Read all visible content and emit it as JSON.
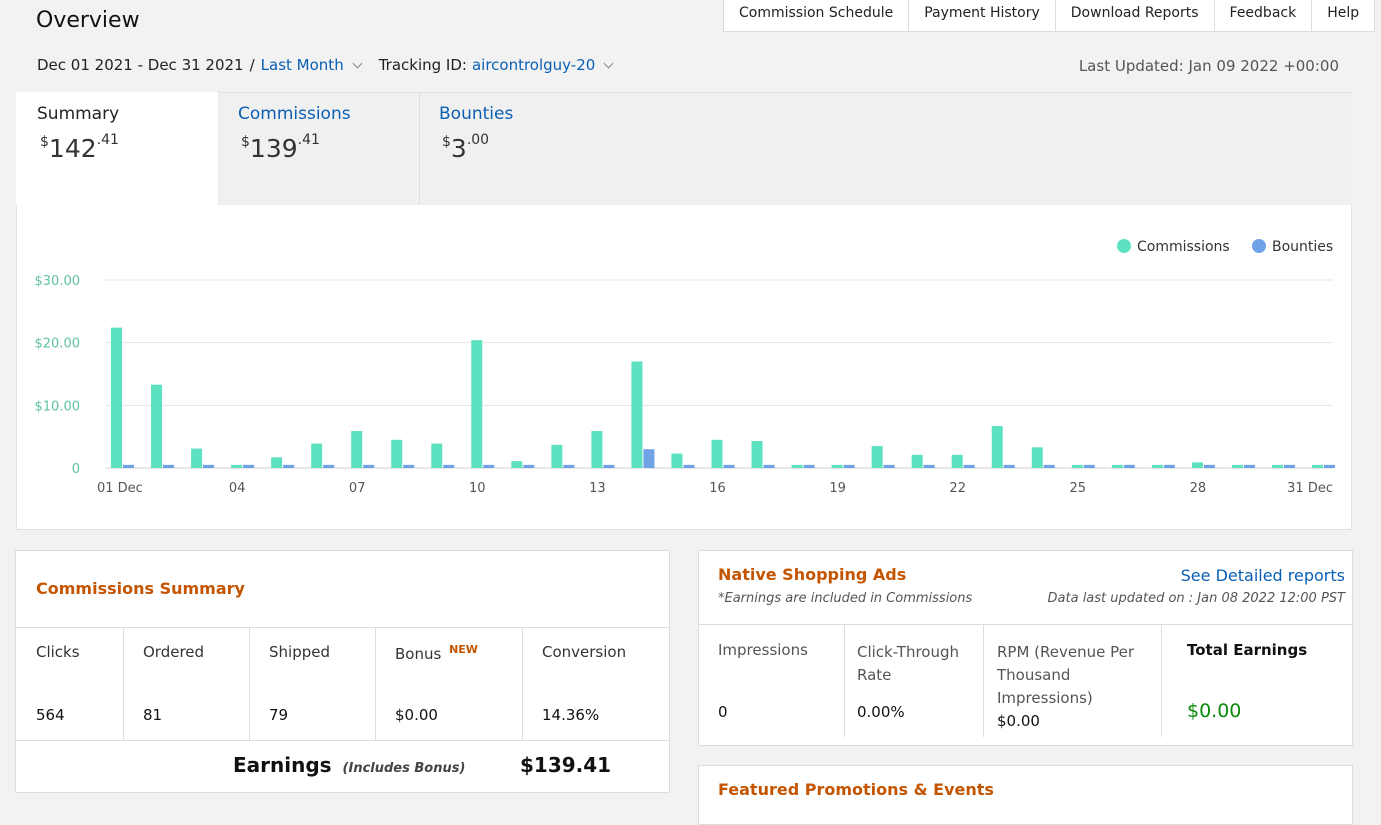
{
  "header": {
    "title": "Overview",
    "nav": [
      "Commission Schedule",
      "Payment History",
      "Download Reports",
      "Feedback",
      "Help"
    ]
  },
  "filters": {
    "date_range": "Dec 01 2021 - Dec 31 2021",
    "separator": "/",
    "period": "Last Month",
    "tracking_label": "Tracking ID:",
    "tracking_id": "aircontrolguy-20",
    "last_updated": "Last Updated: Jan 09 2022 +00:00"
  },
  "tabs": [
    {
      "label": "Summary",
      "currency": "$",
      "whole": "142",
      "cents": ".41"
    },
    {
      "label": "Commissions",
      "currency": "$",
      "whole": "139",
      "cents": ".41"
    },
    {
      "label": "Bounties",
      "currency": "$",
      "whole": "3",
      "cents": ".00"
    }
  ],
  "chart_data": {
    "type": "bar",
    "legend": [
      "Commissions",
      "Bounties"
    ],
    "legend_position": "top-right",
    "colors": {
      "commissions": "#5ce2c0",
      "bounties": "#6fa3e5",
      "grid": "#e4e4e4",
      "tick": "#5fc0a6"
    },
    "y_ticks": [
      "0",
      "$10.00",
      "$20.00",
      "$30.00"
    ],
    "ylim": [
      0,
      30
    ],
    "x_tick_labels": [
      "01 Dec",
      "04",
      "07",
      "10",
      "13",
      "16",
      "19",
      "22",
      "25",
      "28",
      "31 Dec"
    ],
    "x_tick_days": [
      1,
      4,
      7,
      10,
      13,
      16,
      19,
      22,
      25,
      28,
      31
    ],
    "days": [
      1,
      2,
      3,
      4,
      5,
      6,
      7,
      8,
      9,
      10,
      11,
      12,
      13,
      14,
      15,
      16,
      17,
      18,
      19,
      20,
      21,
      22,
      23,
      24,
      25,
      26,
      27,
      28,
      29,
      30,
      31
    ],
    "series": [
      {
        "name": "Commissions",
        "values": [
          22.4,
          13.3,
          3.1,
          0.5,
          1.7,
          3.9,
          5.9,
          4.5,
          3.9,
          20.4,
          1.1,
          3.7,
          5.9,
          17.0,
          2.3,
          4.5,
          4.3,
          0.5,
          0.5,
          3.5,
          2.1,
          2.1,
          6.7,
          3.3,
          0.5,
          0.5,
          0.5,
          0.9,
          0.5,
          0.5,
          0.5
        ]
      },
      {
        "name": "Bounties",
        "values": [
          0.5,
          0.5,
          0.5,
          0.5,
          0.5,
          0.5,
          0.5,
          0.5,
          0.5,
          0.5,
          0.5,
          0.5,
          0.5,
          3.0,
          0.5,
          0.5,
          0.5,
          0.5,
          0.5,
          0.5,
          0.5,
          0.5,
          0.5,
          0.5,
          0.5,
          0.5,
          0.5,
          0.5,
          0.5,
          0.5,
          0.5
        ]
      }
    ]
  },
  "commissions_summary": {
    "title": "Commissions Summary",
    "columns": [
      {
        "label": "Clicks",
        "value": "564"
      },
      {
        "label": "Ordered",
        "value": "81"
      },
      {
        "label": "Shipped",
        "value": "79"
      },
      {
        "label": "Bonus",
        "badge": "NEW",
        "value": "$0.00"
      },
      {
        "label": "Conversion",
        "value": "14.36%"
      }
    ],
    "earnings_label": "Earnings",
    "earnings_note": "(Includes Bonus)",
    "earnings_value": "$139.41"
  },
  "native_ads": {
    "title": "Native Shopping Ads",
    "subtitle": "*Earnings are included in Commissions",
    "report_link": "See Detailed reports",
    "data_updated": "Data last updated on : Jan 08 2022 12:00 PST",
    "columns": [
      {
        "label": "Impressions",
        "value": "0"
      },
      {
        "label": "Click-Through Rate",
        "value": "0.00%"
      },
      {
        "label": "RPM (Revenue Per Thousand Impressions)",
        "value": "$0.00"
      },
      {
        "label": "Total Earnings",
        "value": "$0.00"
      }
    ]
  },
  "featured": {
    "title": "Featured Promotions & Events"
  }
}
